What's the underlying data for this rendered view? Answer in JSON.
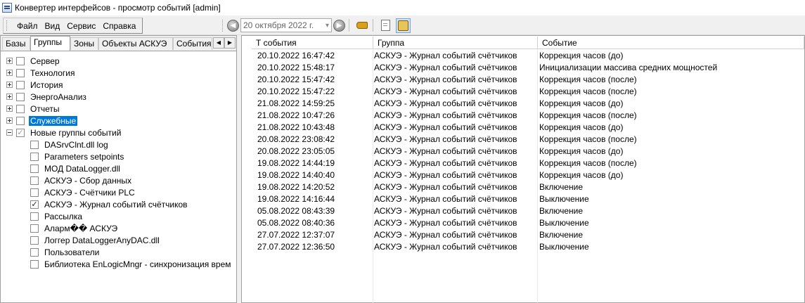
{
  "window": {
    "title": "Конвертер интерфейсов - просмотр событий [admin]"
  },
  "menu": {
    "items": [
      "Файл",
      "Вид",
      "Сервис",
      "Справка"
    ]
  },
  "nav": {
    "date": "20  октября  2022 г."
  },
  "tabs": [
    "Базы",
    "Группы",
    "Зоны",
    "Объекты АСКУЭ",
    "События"
  ],
  "selected_tab": "Группы",
  "tree": [
    {
      "label": "Сервер",
      "level": 0,
      "expander": "plus",
      "checked": false
    },
    {
      "label": "Технология",
      "level": 0,
      "expander": "plus",
      "checked": false
    },
    {
      "label": "История",
      "level": 0,
      "expander": "plus",
      "checked": false
    },
    {
      "label": "ЭнергоАнализ",
      "level": 0,
      "expander": "plus",
      "checked": false
    },
    {
      "label": "Отчеты",
      "level": 0,
      "expander": "plus",
      "checked": false
    },
    {
      "label": "Служебные",
      "level": 0,
      "expander": "plus",
      "checked": false,
      "selected": true
    },
    {
      "label": "Новые группы событий",
      "level": 0,
      "expander": "minus",
      "checked": "partial"
    },
    {
      "label": "DASrvClnt.dll log",
      "level": 1,
      "checked": false
    },
    {
      "label": "Parameters setpoints",
      "level": 1,
      "checked": false
    },
    {
      "label": "МОД DataLogger.dll",
      "level": 1,
      "checked": false
    },
    {
      "label": "АСКУЭ - Сбор данных",
      "level": 1,
      "checked": false
    },
    {
      "label": "АСКУЭ - Счётчики PLC",
      "level": 1,
      "checked": false
    },
    {
      "label": "АСКУЭ - Журнал событий счётчиков",
      "level": 1,
      "checked": true
    },
    {
      "label": "Рассылка",
      "level": 1,
      "checked": false
    },
    {
      "label": "Аларм�� АСКУЭ",
      "level": 1,
      "checked": false
    },
    {
      "label": "Логгер DataLoggerAnyDAC.dll",
      "level": 1,
      "checked": false
    },
    {
      "label": "Пользователи",
      "level": 1,
      "checked": false
    },
    {
      "label": "Библиотека EnLogicMngr - синхронизация врем",
      "level": 1,
      "checked": false
    }
  ],
  "grid": {
    "columns": [
      "Т события",
      "Группа",
      "Событие"
    ],
    "rows": [
      [
        "20.10.2022 16:47:42",
        "АСКУЭ - Журнал событий счётчиков",
        "Коррекция часов (до)"
      ],
      [
        "20.10.2022 15:48:17",
        "АСКУЭ - Журнал событий счётчиков",
        "Инициализации массива средних мощностей"
      ],
      [
        "20.10.2022 15:47:42",
        "АСКУЭ - Журнал событий счётчиков",
        "Коррекция часов (после)"
      ],
      [
        "20.10.2022 15:47:22",
        "АСКУЭ - Журнал событий счётчиков",
        "Коррекция часов (после)"
      ],
      [
        "21.08.2022 14:59:25",
        "АСКУЭ - Журнал событий счётчиков",
        "Коррекция часов (до)"
      ],
      [
        "21.08.2022 10:47:26",
        "АСКУЭ - Журнал событий счётчиков",
        "Коррекция часов (после)"
      ],
      [
        "21.08.2022 10:43:48",
        "АСКУЭ - Журнал событий счётчиков",
        "Коррекция часов (до)"
      ],
      [
        "20.08.2022 23:08:42",
        "АСКУЭ - Журнал событий счётчиков",
        "Коррекция часов (после)"
      ],
      [
        "20.08.2022 23:05:05",
        "АСКУЭ - Журнал событий счётчиков",
        "Коррекция часов (до)"
      ],
      [
        "19.08.2022 14:44:19",
        "АСКУЭ - Журнал событий счётчиков",
        "Коррекция часов (после)"
      ],
      [
        "19.08.2022 14:40:40",
        "АСКУЭ - Журнал событий счётчиков",
        "Коррекция часов (до)"
      ],
      [
        "19.08.2022 14:20:52",
        "АСКУЭ - Журнал событий счётчиков",
        "Включение"
      ],
      [
        "19.08.2022 14:16:44",
        "АСКУЭ - Журнал событий счётчиков",
        "Выключение"
      ],
      [
        "05.08.2022 08:43:39",
        "АСКУЭ - Журнал событий счётчиков",
        "Включение"
      ],
      [
        "05.08.2022 08:40:36",
        "АСКУЭ - Журнал событий счётчиков",
        "Выключение"
      ],
      [
        "27.07.2022 12:37:07",
        "АСКУЭ - Журнал событий счётчиков",
        "Включение"
      ],
      [
        "27.07.2022 12:36:50",
        "АСКУЭ - Журнал событий счётчиков",
        "Выключение"
      ]
    ]
  },
  "icons": {
    "app": "app-window-icon",
    "back": "arrow-left-icon",
    "forward": "arrow-right-icon",
    "tool1": "hand-pointer-icon",
    "tool2": "page-settings-icon",
    "tool3": "lock-page-icon"
  },
  "colors": {
    "selection": "#0078d7",
    "active_button": "#cfe4fa"
  }
}
